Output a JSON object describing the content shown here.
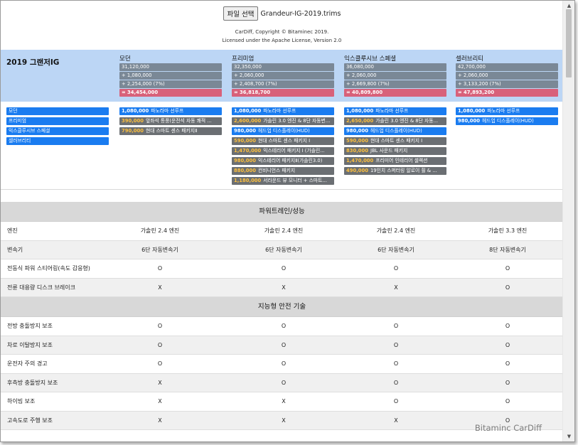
{
  "file_button": "파일 선택",
  "file_name": "Grandeur-IG-2019.trims",
  "credit": [
    "CarDiff, Copyright © Bitaminec 2019.",
    "Licensed under the Apache License, Version 2.0"
  ],
  "model_name": "2019 그랜저IG",
  "trims": [
    {
      "name": "모던",
      "base": "31,120,000",
      "options": "+ 1,080,000",
      "tax": "+ 2,254,000 (7%)",
      "total": "= 34,454,000"
    },
    {
      "name": "프리미엄",
      "base": "32,350,000",
      "options": "+ 2,060,000",
      "tax": "+ 2,408,700 (7%)",
      "total": "= 36,818,700"
    },
    {
      "name": "익스클루시브 스페셜",
      "base": "36,080,000",
      "options": "+ 2,060,000",
      "tax": "+ 2,669,800 (7%)",
      "total": "= 40,809,800"
    },
    {
      "name": "셀러브리티",
      "base": "42,700,000",
      "options": "+ 2,060,000",
      "tax": "+ 3,133,200 (7%)",
      "total": "= 47,893,200"
    }
  ],
  "trim_selector": [
    "모던",
    "프리미엄",
    "익스클루시브 스페셜",
    "셀러브리티"
  ],
  "option_columns": [
    [
      {
        "price": "1,080,000",
        "name": "파노라마 선루프",
        "selected": true
      },
      {
        "price": "390,000",
        "name": "앞좌석 통풍(운전석 자동 쾌적 ...",
        "selected": false
      },
      {
        "price": "790,000",
        "name": "현대 스마트 센스 패키지Ⅱ",
        "selected": false
      }
    ],
    [
      {
        "price": "1,080,000",
        "name": "파노라마 선루프",
        "selected": true
      },
      {
        "price": "2,600,000",
        "name": "가솔린 3.0 엔진 & 8단 자동변...",
        "selected": false
      },
      {
        "price": "980,000",
        "name": "헤드업 디스플레이(HUD)",
        "selected": true
      },
      {
        "price": "590,000",
        "name": "현대 스마트 센스 패키지 I",
        "selected": false
      },
      {
        "price": "1,470,000",
        "name": "익스테리어 패키지 I (가솔린...",
        "selected": false
      },
      {
        "price": "980,000",
        "name": "익스테리어 패키지Ⅱ(가솔린3.0)",
        "selected": false
      },
      {
        "price": "880,000",
        "name": "컨비니언스 패키지",
        "selected": false
      },
      {
        "price": "1,180,000",
        "name": "서라운드 뷰 모니터 + 스마트...",
        "selected": false
      }
    ],
    [
      {
        "price": "1,080,000",
        "name": "파노라마 선루프",
        "selected": true
      },
      {
        "price": "2,650,000",
        "name": "가솔린 3.0 엔진 & 8단 자동...",
        "selected": false
      },
      {
        "price": "980,000",
        "name": "헤드업 디스플레이(HUD)",
        "selected": true
      },
      {
        "price": "590,000",
        "name": "현대 스마트 센스 패키지 I",
        "selected": false
      },
      {
        "price": "830,000",
        "name": "JBL 사운드 패키지",
        "selected": false
      },
      {
        "price": "1,470,000",
        "name": "프리미어 인테리어 셀렉션",
        "selected": false
      },
      {
        "price": "490,000",
        "name": "19인치 스퍼터링 알로이 휠 & ...",
        "selected": false
      }
    ],
    [
      {
        "price": "1,080,000",
        "name": "파노라마 선루프",
        "selected": true
      },
      {
        "price": "980,000",
        "name": "헤드업 디스플레이(HUD)",
        "selected": true
      }
    ]
  ],
  "sections": [
    {
      "title": "파워트레인/성능",
      "rows": [
        {
          "label": "엔진",
          "values": [
            "가솔린 2.4 엔진",
            "가솔린 2.4 엔진",
            "가솔린 2.4 엔진",
            "가솔린 3.3 엔진"
          ]
        },
        {
          "label": "변속기",
          "values": [
            "6단 자동변속기",
            "6단 자동변속기",
            "6단 자동변속기",
            "8단 자동변속기"
          ]
        },
        {
          "label": "전동식 파워 스티어링(속도 감응형)",
          "values": [
            "O",
            "O",
            "O",
            "O"
          ]
        },
        {
          "label": "전륜 대용량 디스크 브레이크",
          "values": [
            "X",
            "X",
            "X",
            "O"
          ]
        }
      ]
    },
    {
      "title": "지능형 안전 기술",
      "rows": [
        {
          "label": "전방 충돌방지 보조",
          "values": [
            "O",
            "O",
            "O",
            "O"
          ]
        },
        {
          "label": "차로 이탈방지 보조",
          "values": [
            "O",
            "O",
            "O",
            "O"
          ]
        },
        {
          "label": "운전자 주의 경고",
          "values": [
            "O",
            "O",
            "O",
            "O"
          ]
        },
        {
          "label": "후측방 충돌방지 보조",
          "values": [
            "X",
            "O",
            "O",
            "O"
          ]
        },
        {
          "label": "하이빔 보조",
          "values": [
            "X",
            "X",
            "O",
            "O"
          ]
        },
        {
          "label": "고속도로 주행 보조",
          "values": [
            "X",
            "X",
            "X",
            "O"
          ]
        }
      ]
    }
  ],
  "watermark": "Bitaminc CarDiff",
  "colors": {
    "band": "#bcd6f5",
    "price_bar": "#7a8896",
    "total_bar": "#d8617a",
    "selected_tag": "#1a7cf0",
    "unselected_tag": "#6b6f73",
    "section_head": "#d8d8d8"
  },
  "icons": {
    "scroll_up": "▲",
    "scroll_down": "▼"
  }
}
